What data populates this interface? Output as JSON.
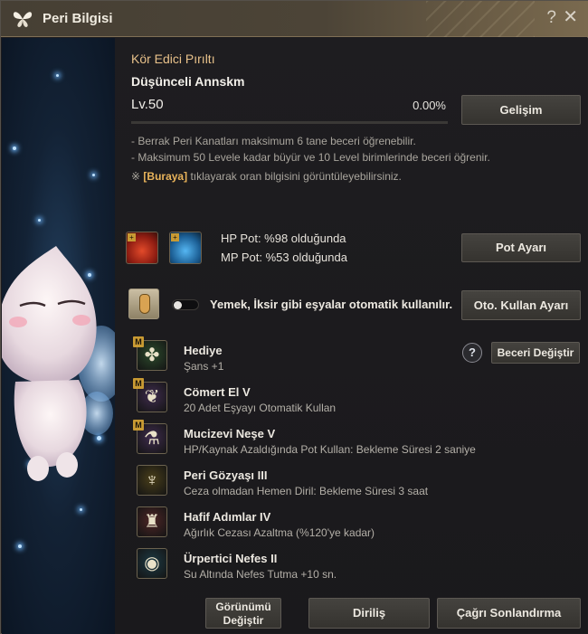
{
  "window": {
    "title": "Peri Bilgisi"
  },
  "pet": {
    "name": "Kör Edici Pırıltı",
    "subname": "Düşünceli Annskm",
    "level_prefix": "Lv.",
    "level": "50",
    "exp_percent_text": "0.00%",
    "exp_fraction": 0.0
  },
  "buttons": {
    "develop": "Gelişim",
    "pot_settings": "Pot Ayarı",
    "auto_use_settings": "Oto. Kullan Ayarı",
    "change_skill": "Beceri Değiştir",
    "change_look_line1": "Görünümü",
    "change_look_line2": "Değiştir",
    "revive": "Diriliş",
    "end_summon": "Çağrı Sonlandırma"
  },
  "info": {
    "line1": "- Berrak Peri Kanatları maksimum 6 tane beceri öğrenebilir.",
    "line2": "- Maksimum 50 Levele kadar büyür ve 10 Level birimlerinde beceri öğrenir.",
    "line3_prefix": "※",
    "line3_link": "[Buraya]",
    "line3_rest": "tıklayarak oran bilgisini görüntüleyebilirsiniz."
  },
  "potions": {
    "hp": "HP Pot: %98 olduğunda",
    "mp": "MP Pot: %53 olduğunda"
  },
  "auto_use": {
    "label": "Yemek, İksir gibi eşyalar otomatik kullanılır.",
    "enabled": false
  },
  "skills": [
    {
      "name": "Hediye",
      "desc": "Şans +1",
      "icon": "clover-icon",
      "master": true,
      "mark": "M",
      "color": "#2c4a2c"
    },
    {
      "name": "Cömert El V",
      "desc": "20 Adet Eşyayı Otomatik Kullan",
      "icon": "fairy-hand-icon",
      "master": true,
      "mark": "M",
      "color": "#3f2c4e"
    },
    {
      "name": "Mucizevi Neşe V",
      "desc": "HP/Kaynak Azaldığında Pot Kullan: Bekleme Süresi 2 saniye",
      "icon": "potion-plus-icon",
      "master": true,
      "mark": "M",
      "color": "#3f2c4e"
    },
    {
      "name": "Peri Gözyaşı III",
      "desc": "Ceza olmadan Hemen Diril: Bekleme Süresi 3 saat",
      "icon": "winged-cup-icon",
      "master": false,
      "mark": "",
      "color": "#4a3f1a"
    },
    {
      "name": "Hafif Adımlar IV",
      "desc": "Ağırlık Cezası Azaltma (%120'ye kadar)",
      "icon": "bag-arrow-icon",
      "master": false,
      "mark": "",
      "color": "#4e2626"
    },
    {
      "name": "Ürpertici Nefes II",
      "desc": "Su Altında Nefes Tutma +10 sn.",
      "icon": "breath-bubble-icon",
      "master": false,
      "mark": "",
      "color": "#1d3a44"
    }
  ],
  "icons": {
    "hp_potion": "hp-potion-icon",
    "mp_potion": "mp-potion-icon",
    "auto_use": "potion-gear-icon",
    "help": "question-icon",
    "close": "close-icon",
    "title": "butterfly-icon"
  },
  "colors": {
    "accent_gold": "#e8b35a",
    "name_gold": "#e8c18a",
    "hp_red": "#c8321e",
    "mp_blue": "#2d8fd6"
  }
}
